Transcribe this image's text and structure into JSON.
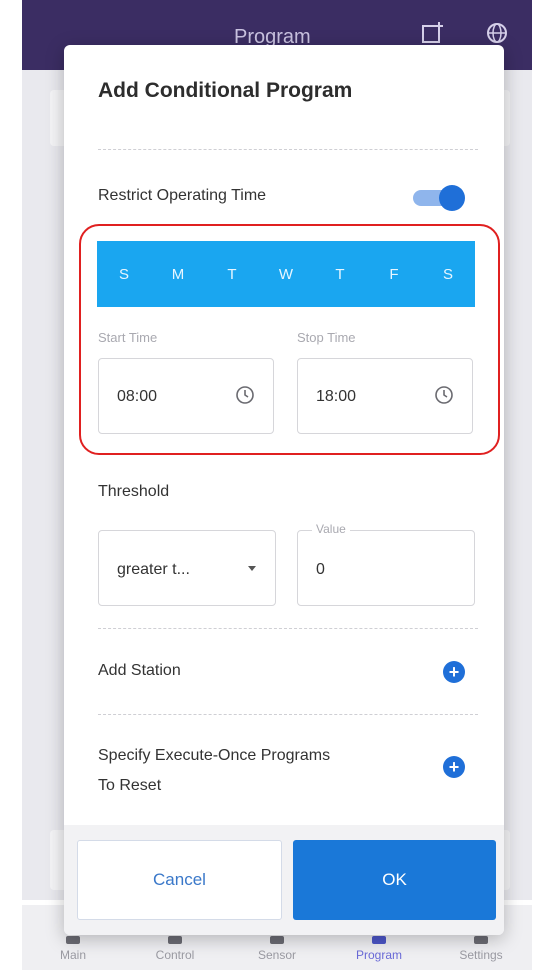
{
  "app": {
    "header_title": "Program",
    "nav": [
      {
        "label": "Main"
      },
      {
        "label": "Control"
      },
      {
        "label": "Sensor"
      },
      {
        "label": "Program"
      },
      {
        "label": "Settings"
      }
    ],
    "active_nav": "Program"
  },
  "modal": {
    "title": "Add Conditional Program",
    "restrict_label": "Restrict Operating Time",
    "restrict_enabled": true,
    "days": [
      "S",
      "M",
      "T",
      "W",
      "T",
      "F",
      "S"
    ],
    "start_time": {
      "label": "Start Time",
      "value": "08:00"
    },
    "stop_time": {
      "label": "Stop Time",
      "value": "18:00"
    },
    "threshold": {
      "label": "Threshold",
      "comparison": "greater t...",
      "value_label": "Value",
      "value": "0"
    },
    "add_station_label": "Add Station",
    "reset_label_line1": "Specify Execute-Once Programs",
    "reset_label_line2": "To Reset",
    "cancel_label": "Cancel",
    "ok_label": "OK"
  },
  "colors": {
    "header": "#3b2d63",
    "accent": "#1f6fd8",
    "days_bar": "#1aa6f0",
    "highlight": "#e02020"
  }
}
